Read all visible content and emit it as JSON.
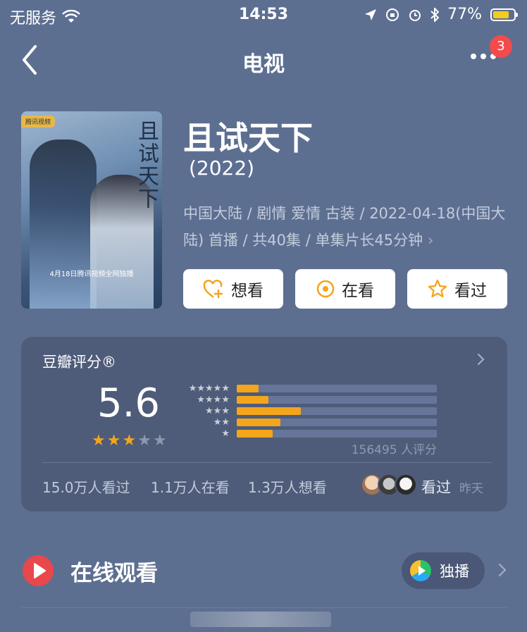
{
  "status_bar": {
    "carrier": "无服务",
    "time": "14:53",
    "battery": "77%",
    "battery_level": 0.77
  },
  "nav": {
    "title": "电视",
    "badge": "3"
  },
  "poster": {
    "corner_tag": "腾讯视频",
    "vertical_title": "且试天下",
    "caption": "4月18日腾讯视频全网独播"
  },
  "show": {
    "title": "且试天下",
    "year": "(2022)",
    "meta": "中国大陆 / 剧情 爱情 古装 / 2022-04-18(中国大陆) 首播 / 共40集 / 单集片长45分钟",
    "meta_chevron": "›"
  },
  "actions": [
    {
      "label": "想看",
      "icon": "heart-plus-icon"
    },
    {
      "label": "在看",
      "icon": "target-icon"
    },
    {
      "label": "看过",
      "icon": "star-outline-icon"
    }
  ],
  "rating": {
    "title": "豆瓣评分®",
    "score": "5.6",
    "stars": 3,
    "count": "156495 人评分",
    "distribution": [
      0.11,
      0.16,
      0.32,
      0.22,
      0.18
    ],
    "colors": {
      "accent": "#f4a51c",
      "bar_bg": "#67759a"
    }
  },
  "stats": {
    "watched": "15.0万人看过",
    "watching": "1.1万人在看",
    "want": "1.3万人想看",
    "seen_label": "看过",
    "seen_when": "昨天"
  },
  "online": {
    "title": "在线观看",
    "pill_label": "独播"
  }
}
